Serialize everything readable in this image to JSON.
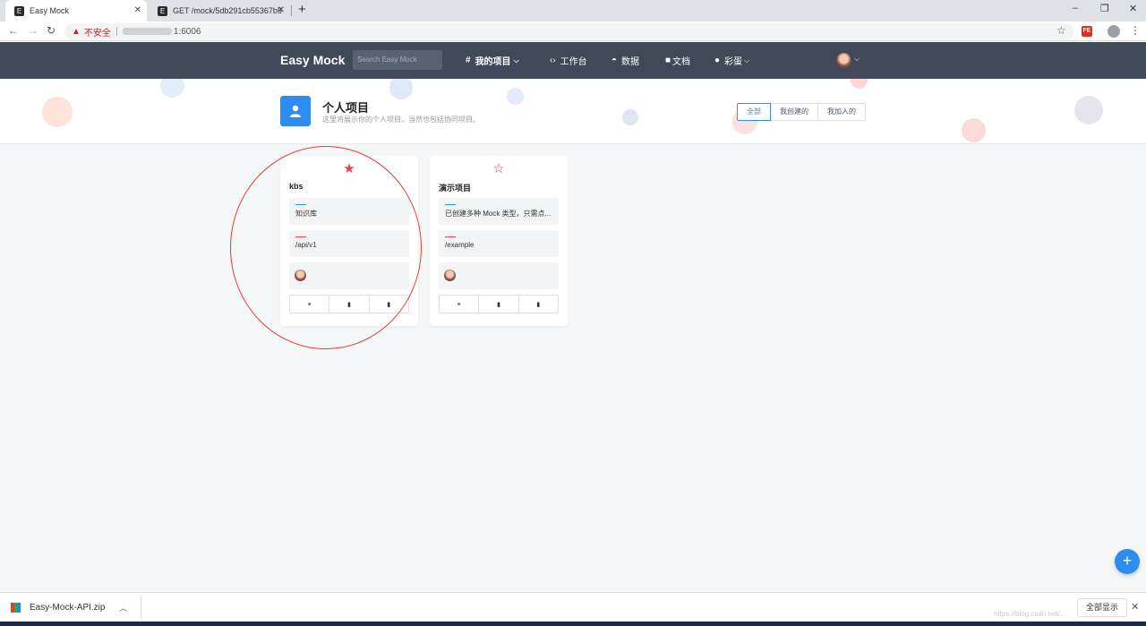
{
  "browser": {
    "tabs": [
      {
        "title": "Easy Mock",
        "active": true
      },
      {
        "title": "GET /mock/5db291cb55367b5",
        "active": false
      }
    ],
    "security_label": "不安全",
    "address_host": "1:6006",
    "new_tab_label": "+",
    "window_controls": {
      "minimize": "–",
      "restore": "❐",
      "close": "✕"
    }
  },
  "app": {
    "logo": "Easy Mock",
    "search_placeholder": "Search Easy Mock",
    "nav": [
      {
        "label": "我的项目",
        "icon": "hash-icon"
      },
      {
        "label": "工作台",
        "icon": "code-icon"
      },
      {
        "label": "数据",
        "icon": "chart-icon"
      },
      {
        "label": "文档",
        "icon": "book-icon"
      },
      {
        "label": "彩蛋",
        "icon": "egg-icon"
      }
    ]
  },
  "page": {
    "title": "个人项目",
    "description": "这里将展示你的个人项目，当然也包括协同项目。",
    "filters": [
      "全部",
      "我创建的",
      "我加入的"
    ],
    "active_filter": "全部"
  },
  "projects": [
    {
      "name": "kbs",
      "starred": true,
      "star": "★",
      "description": "知识库",
      "base_url": "/api/v1",
      "desc_bar_color": "#2d8cf0",
      "url_bar_color": "#ed3f4c"
    },
    {
      "name": "演示项目",
      "starred": false,
      "star": "☆",
      "description": "已创建多种 Mock 类型，只需点...",
      "base_url": "/example",
      "desc_bar_color": "#2d8cf0",
      "url_bar_color": "#ed3f4c"
    }
  ],
  "fab_label": "+",
  "download": {
    "file_name": "Easy-Mock-API.zip",
    "show_all": "全部显示"
  },
  "colors": {
    "nav_bg": "#41485a",
    "accent": "#2d8cf0",
    "star": "#ed3f4c",
    "annotation": "#e0403a"
  }
}
